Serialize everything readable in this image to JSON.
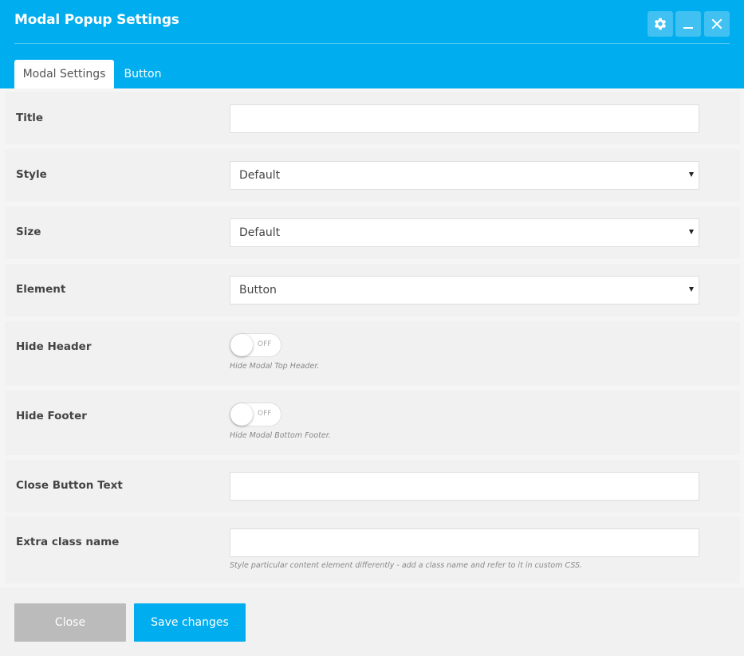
{
  "window": {
    "title": "Modal Popup Settings",
    "controls": [
      "gear-icon",
      "minimize-icon",
      "close-icon"
    ]
  },
  "tabs": [
    {
      "label": "Modal Settings",
      "active": true
    },
    {
      "label": "Button",
      "active": false
    }
  ],
  "fields": {
    "title": {
      "label": "Title",
      "value": ""
    },
    "style": {
      "label": "Style",
      "value": "Default"
    },
    "size": {
      "label": "Size",
      "value": "Default"
    },
    "element": {
      "label": "Element",
      "value": "Button"
    },
    "hide_header": {
      "label": "Hide Header",
      "toggle": "OFF",
      "help": "Hide Modal Top Header."
    },
    "hide_footer": {
      "label": "Hide Footer",
      "toggle": "OFF",
      "help": "Hide Modal Bottom Footer."
    },
    "close_button_text": {
      "label": "Close Button Text",
      "value": ""
    },
    "extra_class": {
      "label": "Extra class name",
      "value": "",
      "help": "Style particular content element differently - add a class name and refer to it in custom CSS."
    }
  },
  "footer": {
    "close_label": "Close",
    "save_label": "Save changes"
  },
  "colors": {
    "accent": "#00adee",
    "close_button": "#bbbbbb",
    "row_background": "#f1f1f1"
  }
}
